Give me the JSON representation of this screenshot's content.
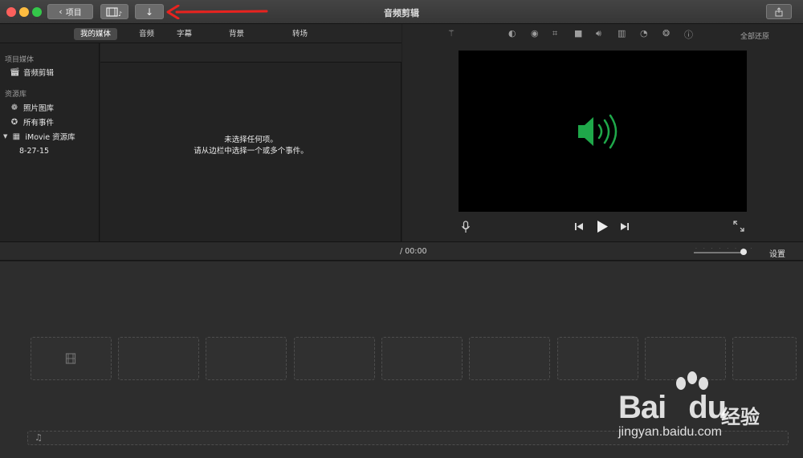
{
  "titlebar": {
    "projects_label": "项目",
    "title": "音频剪辑"
  },
  "tabs": [
    {
      "label": "我的媒体",
      "active": true
    },
    {
      "label": "音频",
      "active": false
    },
    {
      "label": "字幕",
      "active": false
    },
    {
      "label": "背景",
      "active": false
    },
    {
      "label": "转场",
      "active": false
    }
  ],
  "sidebar": {
    "project_media_header": "项目媒体",
    "project_item": "音频剪辑",
    "libraries_header": "资源库",
    "photos_item": "照片图库",
    "all_events_item": "所有事件",
    "imovie_library_item": "iMovie 资源库",
    "event_item": "8-27-15"
  },
  "browser": {
    "empty_line1": "未选择任何项。",
    "empty_line2": "请从边栏中选择一个或多个事件。"
  },
  "viewer": {
    "reset_all": "全部还原",
    "speaker_color": "#1fa84a"
  },
  "timeline": {
    "timecode": "/  00:00",
    "settings_label": "设置",
    "zoom_level": 0.9
  },
  "watermark": {
    "brand": "Bai",
    "brand2": "du",
    "cn": "经验",
    "url": "jingyan.baidu.com"
  },
  "colors": {
    "accent_red": "#e8231f",
    "close": "#fc605c",
    "minimize": "#fdbc40",
    "zoom": "#34c84a"
  }
}
